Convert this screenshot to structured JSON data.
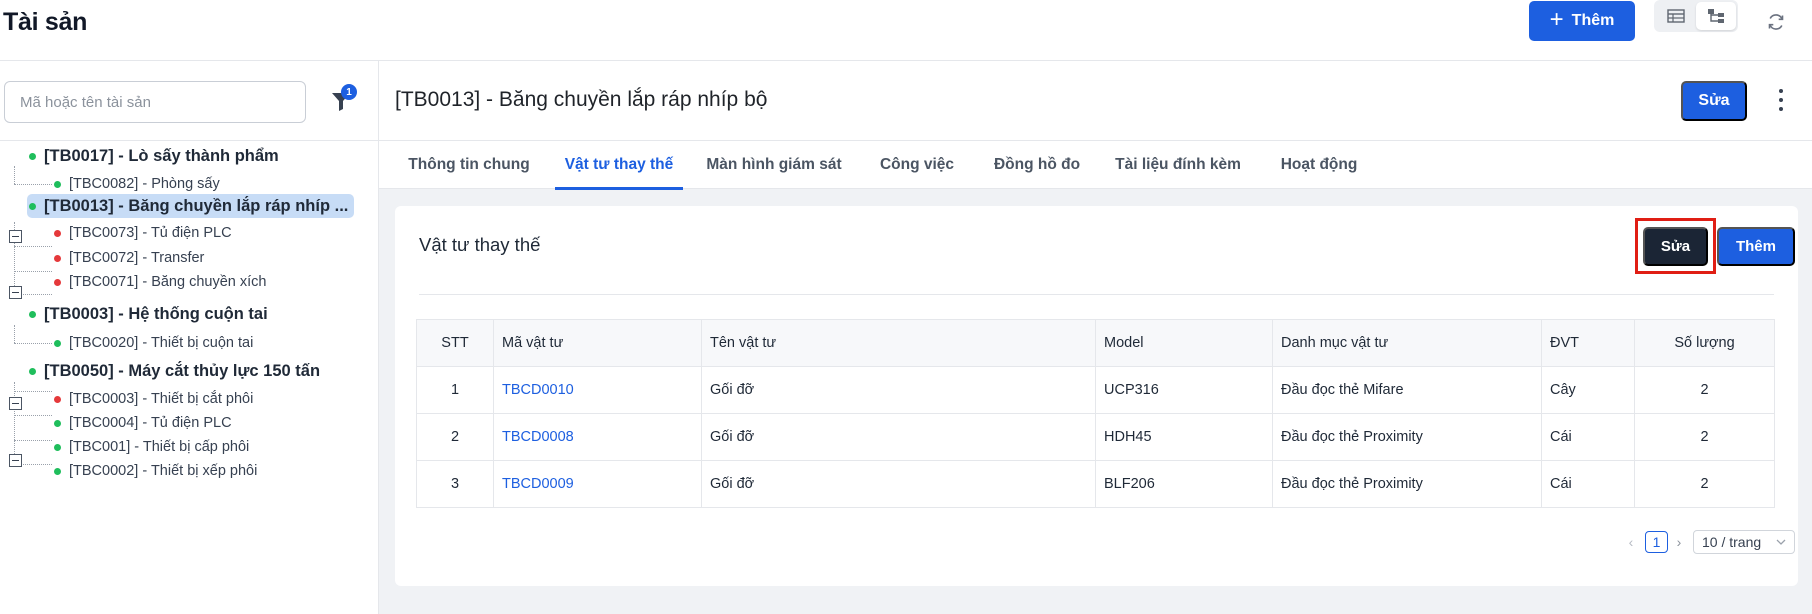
{
  "header": {
    "title": "Tài sản",
    "add_button": "Thêm",
    "view_modes": [
      "table-view-icon",
      "tree-view-icon"
    ],
    "active_view": "tree-view-icon"
  },
  "sidebar": {
    "search_placeholder": "Mã hoặc tên tài sản",
    "filter_count": "1",
    "tree": [
      {
        "label": "[TB0017] - Lò sấy thành phẩm",
        "status": "green",
        "selected": false,
        "children": [
          {
            "label": "[TBC0082] - Phòng sấy",
            "status": "green"
          }
        ]
      },
      {
        "label": "[TB0013] - Băng chuyền lắp ráp nhíp ...",
        "status": "green",
        "selected": true,
        "children": [
          {
            "label": "[TBC0073] - Tủ điện PLC",
            "status": "red"
          },
          {
            "label": "[TBC0072] - Transfer",
            "status": "red"
          },
          {
            "label": "[TBC0071] - Băng chuyền xích",
            "status": "red"
          }
        ]
      },
      {
        "label": "[TB0003] - Hệ thống cuộn tai",
        "status": "green",
        "selected": false,
        "children": [
          {
            "label": "[TBC0020] - Thiết bị cuộn tai",
            "status": "green"
          }
        ]
      },
      {
        "label": "[TB0050] - Máy cắt thủy lực 150 tấn",
        "status": "green",
        "selected": false,
        "children": [
          {
            "label": "[TBC0003] - Thiết bị cắt phôi",
            "status": "red"
          },
          {
            "label": "[TBC0004] - Tủ điện PLC",
            "status": "green"
          },
          {
            "label": "[TBC001] - Thiết bị cấp phôi",
            "status": "green"
          },
          {
            "label": "[TBC0002] - Thiết bị xếp phôi",
            "status": "green"
          }
        ]
      }
    ]
  },
  "detail": {
    "title": "[TB0013] - Băng chuyền lắp ráp nhíp bộ",
    "edit_button": "Sửa",
    "tabs": [
      {
        "label": "Thông tin chung",
        "active": false
      },
      {
        "label": "Vật tư thay thế",
        "active": true
      },
      {
        "label": "Màn hình giám sát",
        "active": false
      },
      {
        "label": "Công việc",
        "active": false
      },
      {
        "label": "Đồng hồ đo",
        "active": false
      },
      {
        "label": "Tài liệu đính kèm",
        "active": false
      },
      {
        "label": "Hoạt động",
        "active": false
      }
    ],
    "card": {
      "title": "Vật tư thay thế",
      "edit_button": "Sửa",
      "add_button": "Thêm",
      "columns": [
        "STT",
        "Mã vật tư",
        "Tên vật tư",
        "Model",
        "Danh mục vật tư",
        "ĐVT",
        "Số lượng"
      ],
      "rows": [
        [
          "1",
          "TBCD0010",
          "Gối đỡ",
          "UCP316",
          "Đầu đọc thẻ Mifare",
          "Cây",
          "2"
        ],
        [
          "2",
          "TBCD0008",
          "Gối đỡ",
          "HDH45",
          "Đầu đọc thẻ Proximity",
          "Cái",
          "2"
        ],
        [
          "3",
          "TBCD0009",
          "Gối đỡ",
          "BLF206",
          "Đầu đọc thẻ Proximity",
          "Cái",
          "2"
        ]
      ],
      "pagination": {
        "current_page": "1",
        "page_size": "10 / trang"
      }
    }
  },
  "colors": {
    "primary": "#1d5fe0",
    "dark_button": "#1b2535",
    "highlight_box": "#e01e14",
    "status_green": "#1fbe5c",
    "status_red": "#e5393b",
    "selected_node_bg": "#c7dcf6"
  }
}
